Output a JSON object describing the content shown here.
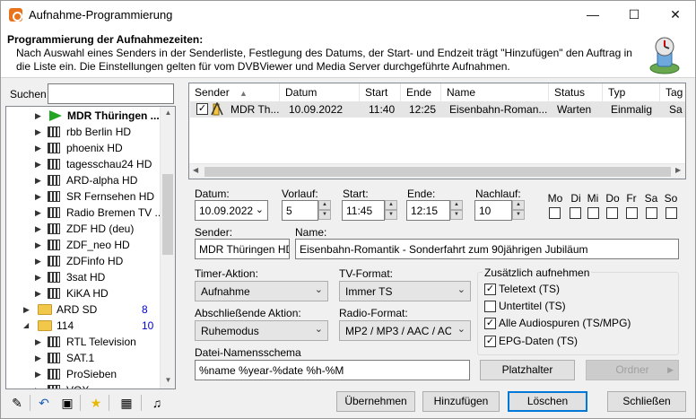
{
  "window": {
    "title": "Aufnahme-Programmierung"
  },
  "header": {
    "title": "Programmierung der Aufnahmezeiten:",
    "description": "Nach Auswahl eines Senders in der Senderliste, Festlegung des Datums, der Start- und Endzeit trägt \"Hinzufügen\" den Auftrag in die Liste ein. Die Einstellungen gelten für vom DVBViewer und Media Server durchgeführte Aufnahmen."
  },
  "search": {
    "label": "Suchen",
    "value": ""
  },
  "tree": [
    {
      "type": "selected",
      "label": "MDR Thüringen ..."
    },
    {
      "type": "channel",
      "label": "rbb Berlin HD"
    },
    {
      "type": "channel",
      "label": "phoenix HD"
    },
    {
      "type": "channel",
      "label": "tagesschau24 HD"
    },
    {
      "type": "channel",
      "label": "ARD-alpha HD"
    },
    {
      "type": "channel",
      "label": "SR Fernsehen HD"
    },
    {
      "type": "channel",
      "label": "Radio Bremen TV ..."
    },
    {
      "type": "channel",
      "label": "ZDF HD (deu)"
    },
    {
      "type": "channel",
      "label": "ZDF_neo HD"
    },
    {
      "type": "channel",
      "label": "ZDFinfo HD"
    },
    {
      "type": "channel",
      "label": "3sat HD"
    },
    {
      "type": "channel",
      "label": "KiKA HD"
    },
    {
      "type": "folder-closed",
      "label": "ARD SD",
      "count": "8"
    },
    {
      "type": "folder-open",
      "label": "114",
      "count": "10"
    },
    {
      "type": "channel",
      "label": "RTL Television"
    },
    {
      "type": "channel",
      "label": "SAT.1"
    },
    {
      "type": "channel",
      "label": "ProSieben"
    },
    {
      "type": "channel",
      "label": "VOX"
    }
  ],
  "job_list": {
    "columns": [
      "Sender",
      "Datum",
      "Start",
      "Ende",
      "Name",
      "Status",
      "Typ",
      "Tag"
    ],
    "rows": [
      {
        "sender": "MDR Th...",
        "datum": "10.09.2022",
        "start": "11:40",
        "ende": "12:25",
        "name": "Eisenbahn-Roman...",
        "status": "Warten",
        "typ": "Einmalig",
        "tag": "Sa",
        "checked": true
      }
    ]
  },
  "form": {
    "datum": {
      "label": "Datum:",
      "value": "10.09.2022"
    },
    "vorlauf": {
      "label": "Vorlauf:",
      "value": "5"
    },
    "start": {
      "label": "Start:",
      "value": "11:45"
    },
    "ende": {
      "label": "Ende:",
      "value": "12:15"
    },
    "nachlauf": {
      "label": "Nachlauf:",
      "value": "10"
    },
    "days": [
      "Mo",
      "Di",
      "Mi",
      "Do",
      "Fr",
      "Sa",
      "So"
    ],
    "sender": {
      "label": "Sender:",
      "value": "MDR Thüringen HD"
    },
    "name": {
      "label": "Name:",
      "value": "Eisenbahn-Romantik - Sonderfahrt zum 90jährigen Jubiläum"
    },
    "timer_aktion": {
      "label": "Timer-Aktion:",
      "value": "Aufnahme"
    },
    "tv_format": {
      "label": "TV-Format:",
      "value": "Immer TS"
    },
    "abschliessende_aktion": {
      "label": "Abschließende Aktion:",
      "value": "Ruhemodus"
    },
    "radio_format": {
      "label": "Radio-Format:",
      "value": "MP2 / MP3 / AAC / AC3"
    },
    "datei_schema": {
      "label": "Datei-Namensschema",
      "value": "%name %year-%date %h-%M"
    },
    "zusaetzlich": {
      "title": "Zusätzlich aufnehmen",
      "items": [
        {
          "label": "Teletext (TS)",
          "checked": true
        },
        {
          "label": "Untertitel (TS)",
          "checked": false
        },
        {
          "label": "Alle Audiospuren (TS/MPG)",
          "checked": true
        },
        {
          "label": "EPG-Daten (TS)",
          "checked": true
        }
      ]
    }
  },
  "buttons": {
    "platzhalter": "Platzhalter",
    "ordner": "Ordner",
    "uebernehmen": "Übernehmen",
    "hinzufuegen": "Hinzufügen",
    "loeschen": "Löschen",
    "schliessen": "Schließen"
  },
  "colors": {
    "selection_border": "#0078d7",
    "count_blue": "#0000d8",
    "play_green": "#22a522"
  }
}
